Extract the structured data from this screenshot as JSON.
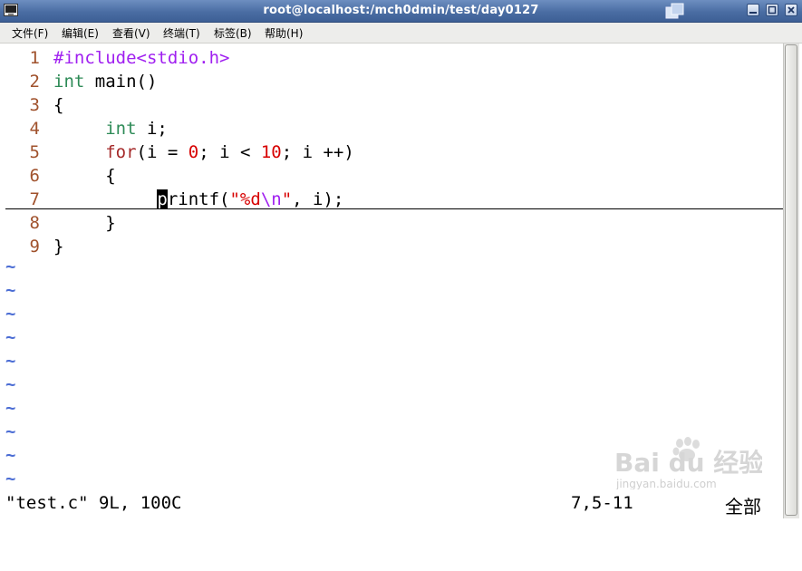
{
  "window": {
    "title": "root@localhost:/mch0dmin/test/day0127"
  },
  "menu": [
    {
      "label": "文件(F)"
    },
    {
      "label": "编辑(E)"
    },
    {
      "label": "查看(V)"
    },
    {
      "label": "终端(T)"
    },
    {
      "label": "标签(B)"
    },
    {
      "label": "帮助(H)"
    }
  ],
  "editor": {
    "lines": [
      {
        "num": "1",
        "tokens": [
          {
            "t": "#include<stdio.h>",
            "c": "kw-pre"
          }
        ]
      },
      {
        "num": "2",
        "tokens": [
          {
            "t": "int",
            "c": "kw-type"
          },
          {
            "t": " main()",
            "c": ""
          }
        ]
      },
      {
        "num": "3",
        "tokens": [
          {
            "t": "{",
            "c": ""
          }
        ]
      },
      {
        "num": "4",
        "tokens": [
          {
            "t": "     ",
            "c": ""
          },
          {
            "t": "int",
            "c": "kw-type"
          },
          {
            "t": " i;",
            "c": ""
          }
        ]
      },
      {
        "num": "5",
        "tokens": [
          {
            "t": "     ",
            "c": ""
          },
          {
            "t": "for",
            "c": "kw-stmt"
          },
          {
            "t": "(i = ",
            "c": ""
          },
          {
            "t": "0",
            "c": "num"
          },
          {
            "t": "; i < ",
            "c": ""
          },
          {
            "t": "10",
            "c": "num"
          },
          {
            "t": "; i ++)",
            "c": ""
          }
        ]
      },
      {
        "num": "6",
        "tokens": [
          {
            "t": "     {",
            "c": ""
          }
        ]
      },
      {
        "num": "7",
        "tokens": [
          {
            "t": "          ",
            "c": ""
          },
          {
            "t": "p",
            "c": "cursor"
          },
          {
            "t": "rintf(",
            "c": ""
          },
          {
            "t": "\"%d",
            "c": "str"
          },
          {
            "t": "\\n",
            "c": "kw-pre"
          },
          {
            "t": "\"",
            "c": "str"
          },
          {
            "t": ", i);",
            "c": ""
          }
        ]
      },
      {
        "num": "8",
        "tokens": [
          {
            "t": "     }",
            "c": ""
          }
        ]
      },
      {
        "num": "9",
        "tokens": [
          {
            "t": "}",
            "c": ""
          }
        ]
      }
    ],
    "tilde": "~",
    "colors": {
      "line_number": "#a0522d",
      "type": "#2e8b57",
      "statement": "#a52a2a",
      "preproc": "#a020f0",
      "constant": "#d70000",
      "nontext": "#4a6cd4"
    }
  },
  "status": {
    "file_info": "\"test.c\" 9L, 100C",
    "position": "7,5-11",
    "scroll": "全部"
  },
  "watermark": {
    "logo": "Bai du 经验",
    "url": "jingyan.baidu.com"
  }
}
